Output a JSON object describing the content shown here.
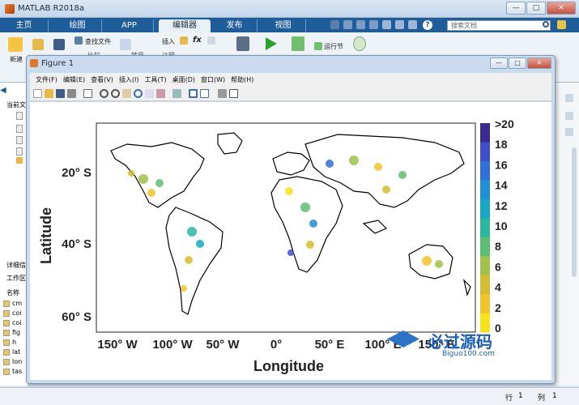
{
  "app": {
    "title": "MATLAB R2018a",
    "window_controls": [
      "—",
      "□",
      "✕"
    ]
  },
  "ribbon": {
    "tabs": [
      "主页",
      "绘图",
      "APP",
      "编辑器",
      "发布",
      "视图"
    ],
    "active": "编辑器",
    "search_placeholder": "搜索文档",
    "labels": {
      "new": "新建",
      "find_files": "查找文件",
      "compare": "比较",
      "insert": "插入",
      "go_to": "转至",
      "comment": "注释",
      "run_section": "运行节",
      "fx": "fx"
    }
  },
  "left_panel": {
    "current_folder": "当前文",
    "details": "详细信",
    "workspace": "工作区",
    "name_header": "名称",
    "vars": [
      "cm",
      "coi",
      "coi",
      "fig",
      "h",
      "lat",
      "lon",
      "tas"
    ]
  },
  "figure": {
    "title": "Figure 1",
    "menu": [
      "文件(F)",
      "编辑(E)",
      "查看(V)",
      "插入(I)",
      "工具(T)",
      "桌面(D)",
      "窗口(W)",
      "帮助(H)"
    ],
    "xlabel": "Longitude",
    "ylabel": "Latitude",
    "xticks": [
      "150° W",
      "100° W",
      "50° W",
      "0°",
      "50° E",
      "100° E",
      "150° E"
    ],
    "yticks": [
      "20° S",
      "40° S",
      "60° S"
    ],
    "colorbar": {
      "labels": [
        ">20",
        "18",
        "16",
        "14",
        "12",
        "10",
        "8",
        "6",
        "4",
        "2",
        "0"
      ],
      "colors": [
        "#3b2a8f",
        "#3e4fc9",
        "#2f6fd8",
        "#1f8fd6",
        "#16a8c2",
        "#2ab7a0",
        "#5dbf72",
        "#9fc24a",
        "#d4bd30",
        "#f2c42a",
        "#f8e31a"
      ]
    }
  },
  "statusbar": {
    "line_label": "行",
    "line": "1",
    "col_label": "列",
    "col": "1"
  },
  "watermark": {
    "text": "必过源码",
    "url": "Biguo100.com"
  }
}
